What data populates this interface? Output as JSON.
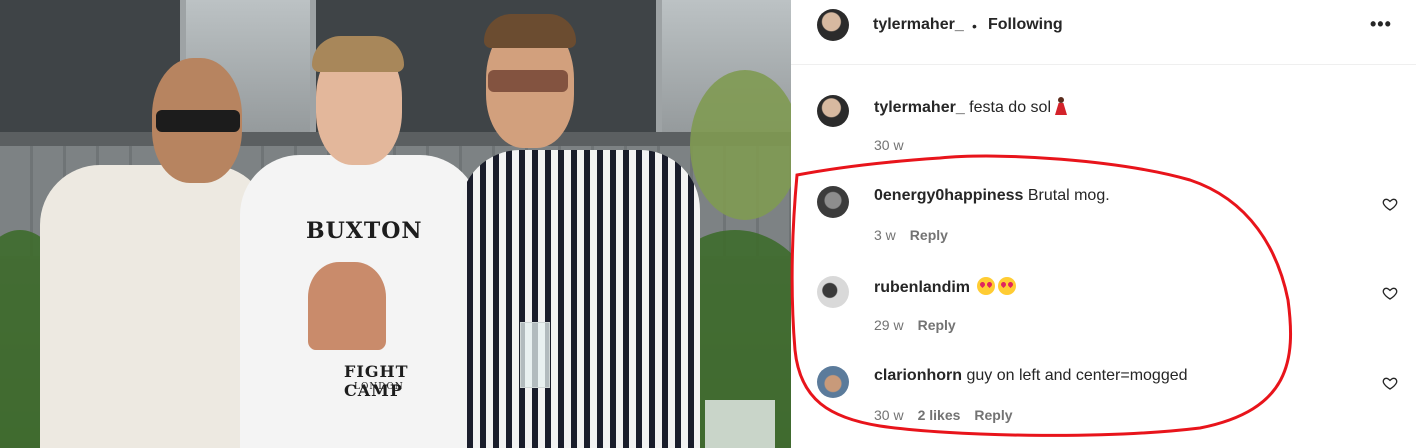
{
  "post": {
    "header": {
      "username": "tylermaher_",
      "separator": "•",
      "follow_label": "Following",
      "more_icon": "more-horizontal-icon"
    },
    "caption": {
      "username": "tylermaher_",
      "text": "festa do sol",
      "emoji": "dancer-emoji",
      "time": "30 w"
    },
    "photo": {
      "shirt_text_top": "BUXTON",
      "shirt_text_bottom": "FIGHT CAMP",
      "shirt_text_small": "LONDON"
    },
    "comments": [
      {
        "username": "0energy0happiness",
        "text": "Brutal mog.",
        "time": "3 w",
        "likes": "",
        "reply_label": "Reply"
      },
      {
        "username": "rubenlandim",
        "text": "",
        "emojis": [
          "heart-eyes-emoji",
          "heart-eyes-emoji"
        ],
        "time": "29 w",
        "likes": "",
        "reply_label": "Reply"
      },
      {
        "username": "clarionhorn",
        "text": "guy on left and center=mogged",
        "time": "30 w",
        "likes": "2 likes",
        "reply_label": "Reply"
      }
    ],
    "annotation_color": "#e8141b"
  }
}
